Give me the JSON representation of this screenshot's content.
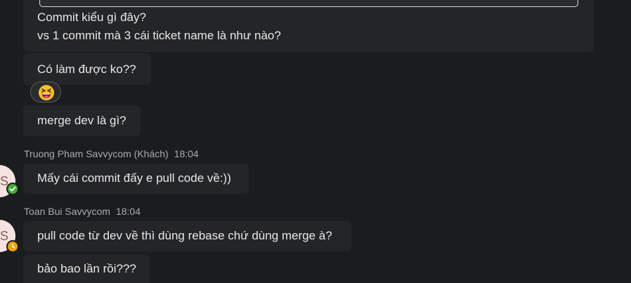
{
  "messages": {
    "m1": {
      "line1": "Commit kiểu gì đây?",
      "line2": "vs 1 commit mà 3 cái ticket name là như nào?"
    },
    "m2": {
      "text": "Có làm được ko??"
    },
    "reaction": {
      "icon": "grinning-squinting-face-emoji"
    },
    "m3": {
      "text": "merge dev là gì?"
    },
    "group2": {
      "author": "Truong Pham Savvycom (Khách)",
      "time": "18:04",
      "avatar_text": "TS",
      "status": "available",
      "status_color": "#46a83a",
      "text": "Mấy cái commit đấy e pull code về:))"
    },
    "group3": {
      "author": "Toan Bui Savvycom",
      "time": "18:04",
      "avatar_text": "TS",
      "status": "away",
      "status_color": "#f0a30a",
      "m1": "pull code từ dev về thì dùng rebase chứ dùng merge à?",
      "m2": "bảo bao lần rồi???"
    }
  }
}
